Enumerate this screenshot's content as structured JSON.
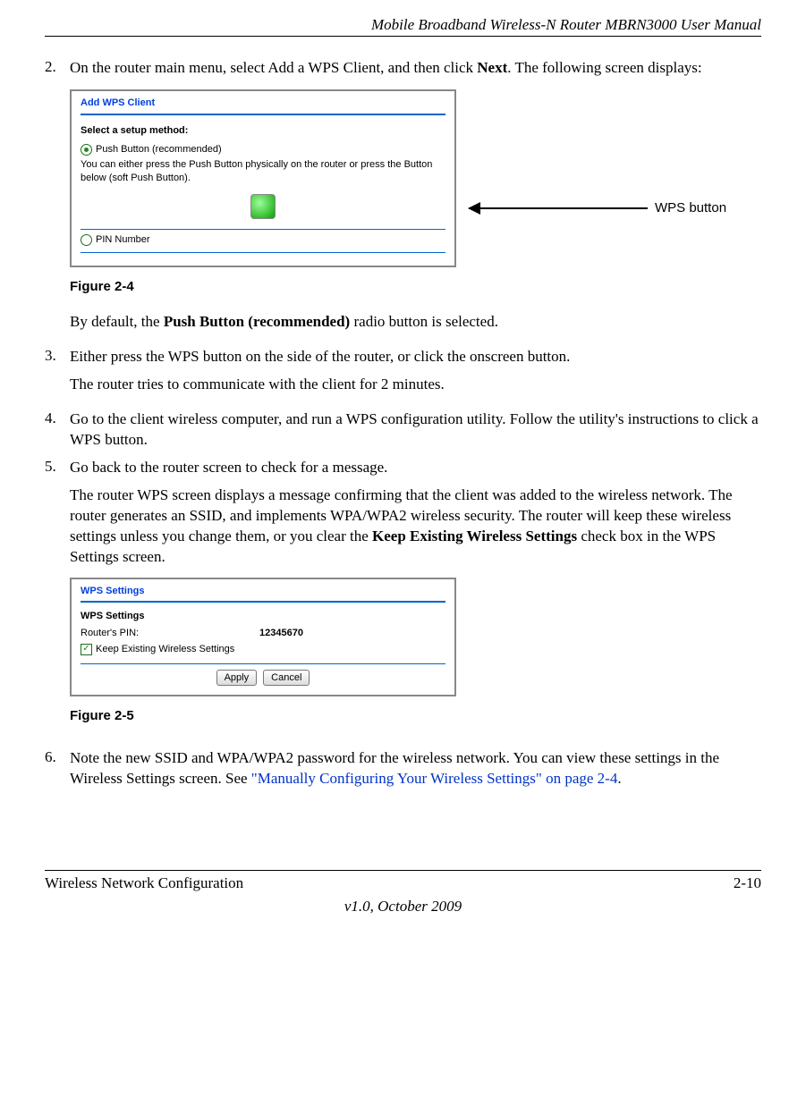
{
  "header": "Mobile Broadband Wireless-N Router MBRN3000 User Manual",
  "steps": {
    "s2": {
      "num": "2.",
      "text_a": "On the router main menu, select Add a WPS Client, and then click ",
      "bold_a": "Next",
      "text_b": ". The following screen displays:",
      "after": "By default, the ",
      "after_bold": "Push Button (recommended)",
      "after_tail": " radio button is selected."
    },
    "s3": {
      "num": "3.",
      "text": "Either press the WPS button on the side of the router, or click the onscreen button.",
      "after": "The router tries to communicate with the client for 2 minutes."
    },
    "s4": {
      "num": "4.",
      "text": "Go to the client wireless computer, and run a WPS configuration utility. Follow the utility's instructions to click a WPS button."
    },
    "s5": {
      "num": "5.",
      "text": "Go back to the router screen to check for a message.",
      "after_a": "The router WPS screen displays a message confirming that the client was added to the wireless network. The router generates an SSID, and implements WPA/WPA2 wireless security. The router will keep these wireless settings unless you change them, or you clear the ",
      "after_bold": "Keep Existing Wireless Settings",
      "after_b": " check box in the WPS Settings screen."
    },
    "s6": {
      "num": "6.",
      "text_a": "Note the new SSID and WPA/WPA2 password for the wireless network. You can view these settings in the Wireless Settings screen. See ",
      "link": "\"Manually Configuring Your Wireless Settings\" on page 2-4",
      "text_b": "."
    }
  },
  "fig1": {
    "title": "Add WPS Client",
    "sec_label": "Select a setup method:",
    "opt_push": "Push Button (recommended)",
    "push_desc": "You can either press the Push Button physically on the router or press the Button below (soft Push Button).",
    "opt_pin": "PIN Number",
    "caption": "Figure 2-4"
  },
  "anno": {
    "label": "WPS button"
  },
  "fig2": {
    "title": "WPS Settings",
    "sub": "WPS Settings",
    "pin_label": "Router's PIN:",
    "pin_value": "12345670",
    "keep_label": "Keep Existing Wireless Settings",
    "apply": "Apply",
    "cancel": "Cancel",
    "caption": "Figure 2-5"
  },
  "footer": {
    "left": "Wireless Network Configuration",
    "right": "2-10",
    "center": "v1.0, October 2009"
  }
}
